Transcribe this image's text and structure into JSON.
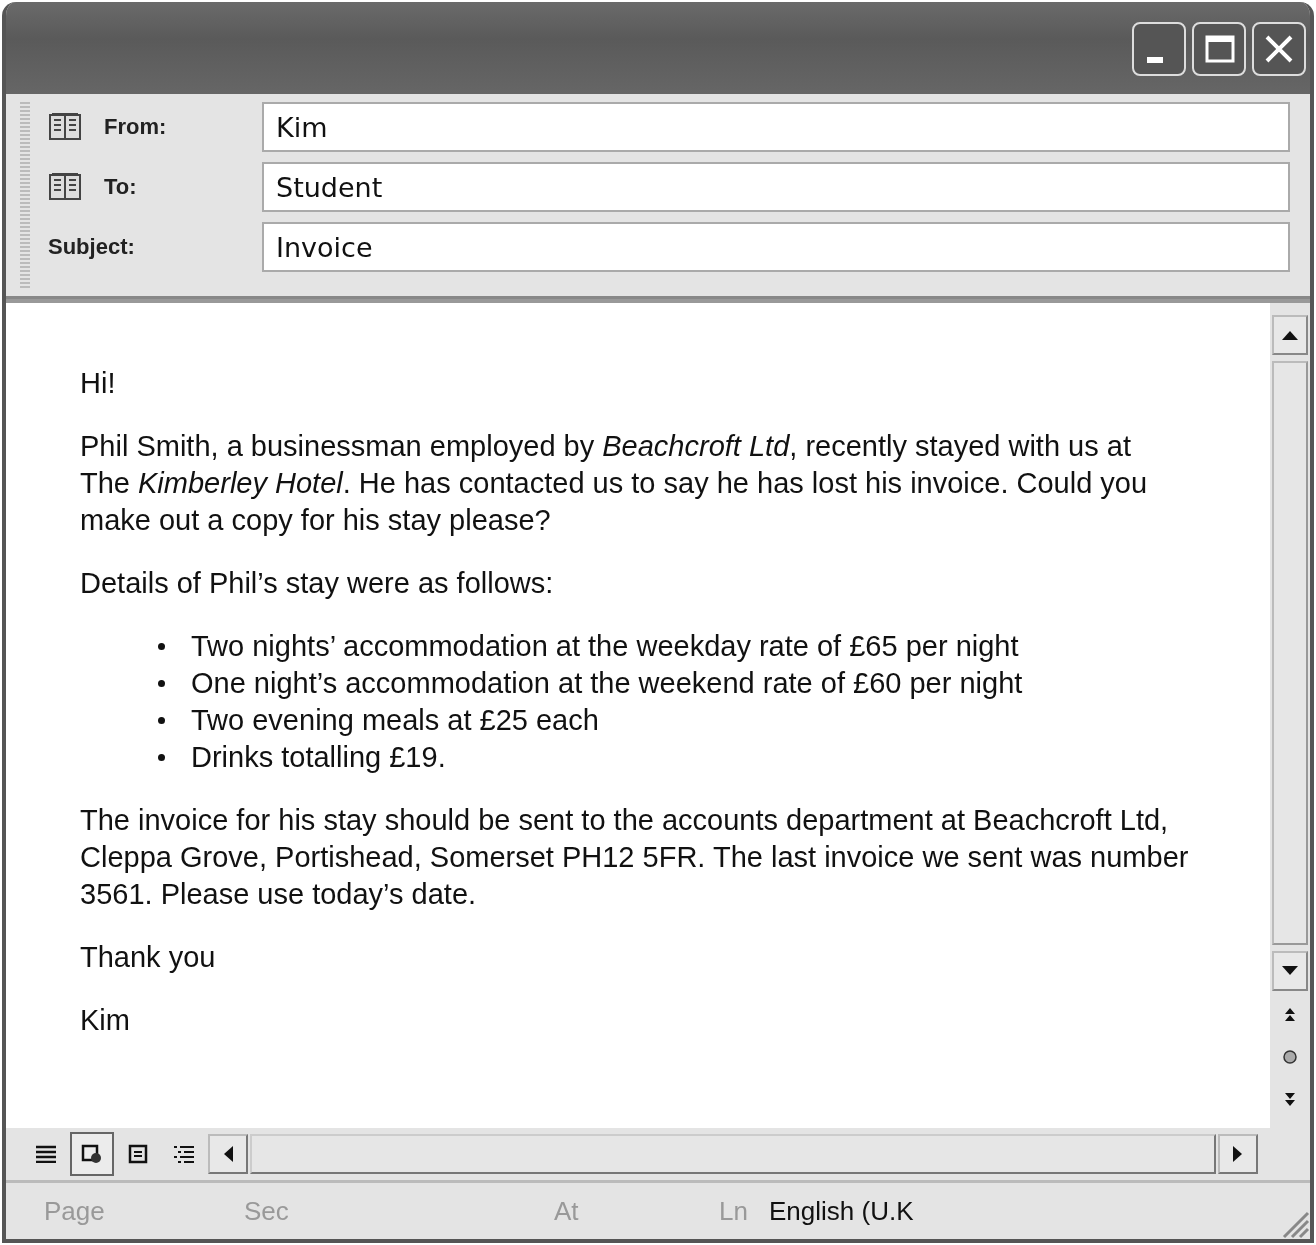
{
  "window": {
    "controls": [
      {
        "kind": "minimize"
      },
      {
        "kind": "maximize"
      },
      {
        "kind": "close"
      }
    ]
  },
  "header": {
    "fields": [
      {
        "label": "From:",
        "value": "Kim",
        "kind": "address"
      },
      {
        "label": "To:",
        "value": "Student",
        "kind": "address"
      },
      {
        "label": "Subject:",
        "value": "Invoice",
        "kind": "plain"
      }
    ]
  },
  "body": {
    "blocks": [
      {
        "kind": "paragraph",
        "text": "Hi!"
      },
      {
        "kind": "paragraph",
        "lines": [
          "Phil Smith, a businessman employed by *Beachcroft Ltd*, recently stayed with us at",
          "The *Kimberley Hotel*. He has contacted us to say he has lost his invoice. Could you",
          "make out a copy for his stay please?"
        ]
      },
      {
        "kind": "paragraph",
        "text": "Details of Phil’s stay were as follows:"
      },
      {
        "kind": "bullets",
        "items": [
          "Two nights’ accommodation at the weekday rate of £65 per night",
          "One night’s accommodation at the weekend rate of £60 per night",
          "Two evening meals at £25 each",
          "Drinks totalling £19."
        ]
      },
      {
        "kind": "paragraph",
        "lines": [
          "The invoice for his stay should be sent to the accounts department at Beachcroft Ltd,",
          "Cleppa Grove, Portishead, Somerset PH12 5FR. The last invoice we sent was number",
          "3561. Please use today’s date."
        ]
      },
      {
        "kind": "paragraph",
        "text": "Thank you"
      },
      {
        "kind": "paragraph",
        "text": "Kim"
      }
    ]
  },
  "view_buttons": [
    {
      "kind": "normal",
      "selected": false
    },
    {
      "kind": "web",
      "selected": true
    },
    {
      "kind": "print",
      "selected": false
    },
    {
      "kind": "outline",
      "selected": false
    }
  ],
  "status_bar": [
    {
      "text": "Page",
      "disabled": true
    },
    {
      "text": "Sec",
      "disabled": true
    },
    {
      "text": "At",
      "disabled": true
    },
    {
      "text": "Ln",
      "disabled": true
    },
    {
      "text": "English (U.K",
      "disabled": false
    }
  ]
}
